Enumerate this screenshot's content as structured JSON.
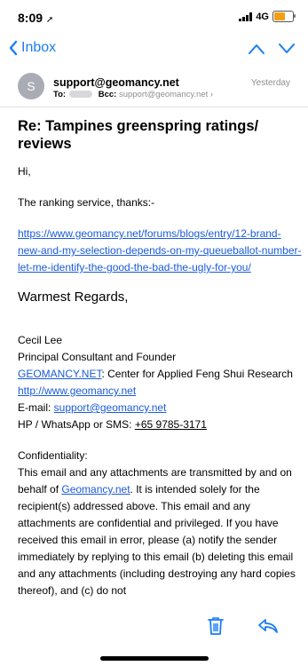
{
  "status_bar": {
    "time": "8:09",
    "network": "4G"
  },
  "nav": {
    "back_label": "Inbox"
  },
  "message": {
    "avatar_initial": "S",
    "from": "support@geomancy.net",
    "date": "Yesterday",
    "to_label": "To:",
    "bcc_label": "Bcc:",
    "bcc_value": "support@geomancy.net",
    "subject": "Re:  Tampines greenspring ratings/ reviews"
  },
  "body": {
    "greeting": "Hi,",
    "intro": "The ranking service, thanks:-",
    "link": "https://www.geomancy.net/forums/blogs/entry/12-brand-new-and-my-selection-depends-on-my-queueballot-number-let-me-identify-the-good-the-bad-the-ugly-for-you/",
    "regards": "Warmest Regards,",
    "sig_name": "Cecil Lee",
    "sig_title": "Principal Consultant and Founder",
    "sig_org_link": "GEOMANCY.NET",
    "sig_org_text": ": Center for Applied Feng Shui Research ",
    "sig_site": "http://www.geomancy.net",
    "email_label": "E-mail: ",
    "email": "support@geomancy.net",
    "phone_label": "HP / WhatsApp or SMS: ",
    "phone": "+65 9785-3171",
    "conf_heading": "Confidentiality:",
    "conf_1": "This email and any attachments are transmitted by and on behalf of ",
    "conf_link": "Geomancy.net",
    "conf_2": ".  It is intended solely for the recipient(s) addressed above. This email and any attachments are confidential and privileged. If you have received this email in error, please (a) notify the sender immediately by replying to this email (b) deleting this email and any attachments (including destroying any hard copies thereof), and (c) do not"
  },
  "colors": {
    "accent": "#1a7cf5",
    "link": "#1a5bd8",
    "battery": "#f1a016"
  }
}
